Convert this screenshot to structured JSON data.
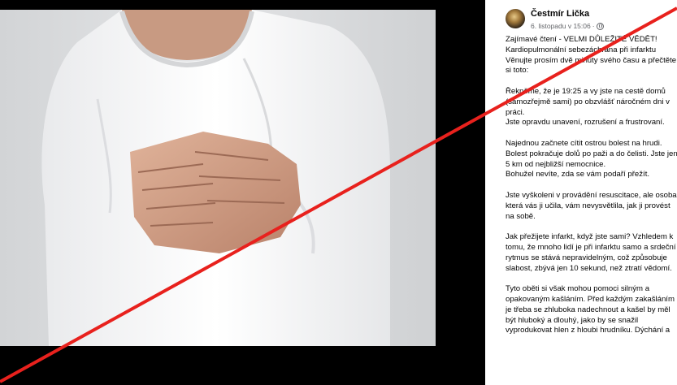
{
  "post": {
    "author": "Čestmír Lička",
    "date": "6. listopadu v 15:06",
    "separator": "·",
    "lines": [
      "Zajímavé čtení - VELMI DŮLEŽITÉ VĚDĚT!",
      "Kardiopulmonální sebezáchrana při infarktu",
      "Věnujte prosím dvě minuty svého času a přečtěte",
      "si toto:",
      "",
      "Řekněme, že je 19:25 a vy jste na cestě domů",
      "(samozřejmě sami) po obzvlášť náročném dni v",
      "práci.",
      "Jste opravdu unavení, rozrušení a frustrovaní.",
      "",
      "Najednou začnete cítit ostrou bolest na hrudi.",
      "Bolest pokračuje dolů po paži a do čelisti. Jste jen",
      "5 km od nejbližší nemocnice.",
      "Bohužel nevíte, zda se vám podaří přežít.",
      "",
      "Jste vyškoleni v provádění resuscitace, ale osoba,",
      "která vás ji učila, vám nevysvětlila, jak ji provést",
      "na sobě.",
      "",
      "Jak přežijete infarkt, když jste sami? Vzhledem k",
      "tomu, že mnoho lidí je při infarktu samo a srdeční",
      "rytmus se stává nepravidelným, což způsobuje",
      "slabost, zbývá jen 10 sekund, než ztratí vědomí.",
      "",
      "Tyto oběti si však mohou pomoci silným a",
      "opakovaným kašláním. Před každým zakašláním",
      "je třeba se zhluboka nadechnout a kašel by měl",
      "být hluboký a dlouhý, jako by se snažil",
      "vyprodukovat hlen z hloubi hrudníku. Dýchání a"
    ]
  }
}
